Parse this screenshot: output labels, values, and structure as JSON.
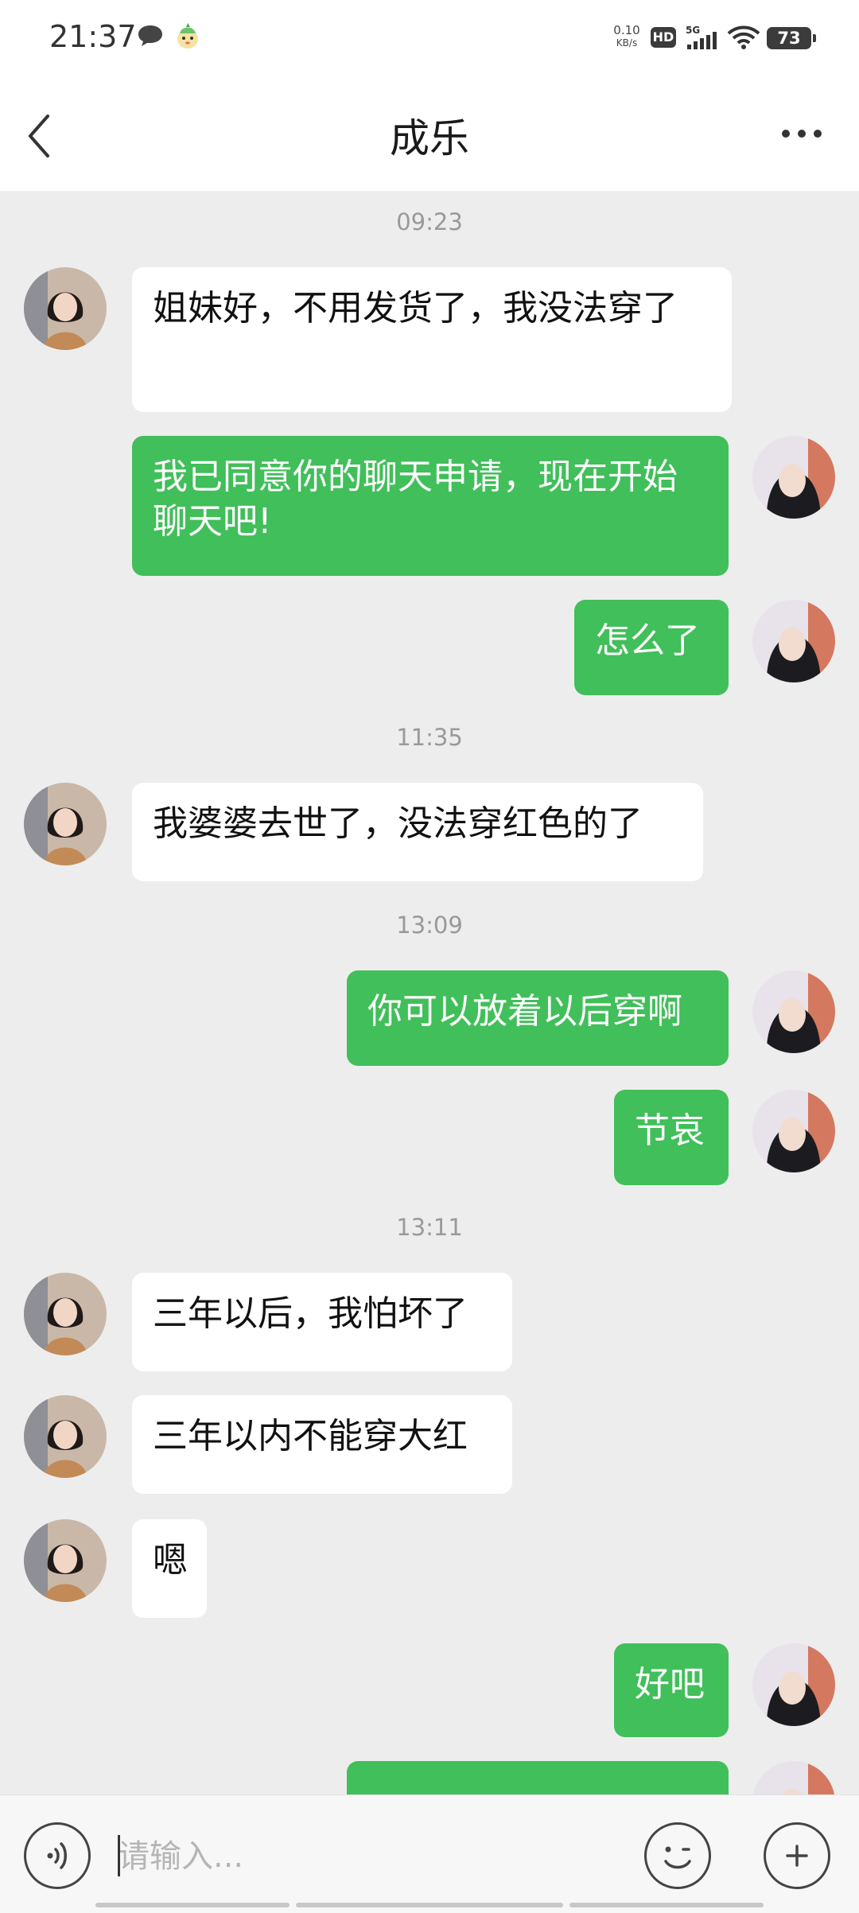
{
  "status_bar": {
    "time": "21:37",
    "net_speed": "0.10",
    "net_unit": "KB/s",
    "hd": "HD",
    "signal": "5G",
    "battery": "73"
  },
  "header": {
    "title": "成乐"
  },
  "messages": [
    {
      "type": "time",
      "text": "09:23"
    },
    {
      "type": "msg",
      "side": "in",
      "text": "姐妹好，不用发货了，我没法穿了"
    },
    {
      "type": "msg",
      "side": "out",
      "text": "我已同意你的聊天申请，现在开始聊天吧!"
    },
    {
      "type": "msg",
      "side": "out",
      "text": "怎么了"
    },
    {
      "type": "time",
      "text": "11:35"
    },
    {
      "type": "msg",
      "side": "in",
      "text": "我婆婆去世了，没法穿红色的了"
    },
    {
      "type": "time",
      "text": "13:09"
    },
    {
      "type": "msg",
      "side": "out",
      "text": "你可以放着以后穿啊"
    },
    {
      "type": "msg",
      "side": "out",
      "text": "节哀"
    },
    {
      "type": "time",
      "text": "13:11"
    },
    {
      "type": "msg",
      "side": "in",
      "text": "三年以后，我怕坏了"
    },
    {
      "type": "msg",
      "side": "in",
      "text": "三年以内不能穿大红"
    },
    {
      "type": "msg",
      "side": "in",
      "text": "嗯"
    },
    {
      "type": "msg",
      "side": "out",
      "text": "好吧"
    },
    {
      "type": "msg",
      "side": "out",
      "text": ""
    }
  ],
  "input": {
    "placeholder": "请输入..."
  },
  "colors": {
    "out_bubble": "#41bf5a",
    "in_bubble": "#ffffff",
    "background": "#ededed"
  },
  "icons": [
    "back-arrow-icon",
    "more-dots-icon",
    "voice-icon",
    "emoji-icon",
    "plus-icon"
  ]
}
